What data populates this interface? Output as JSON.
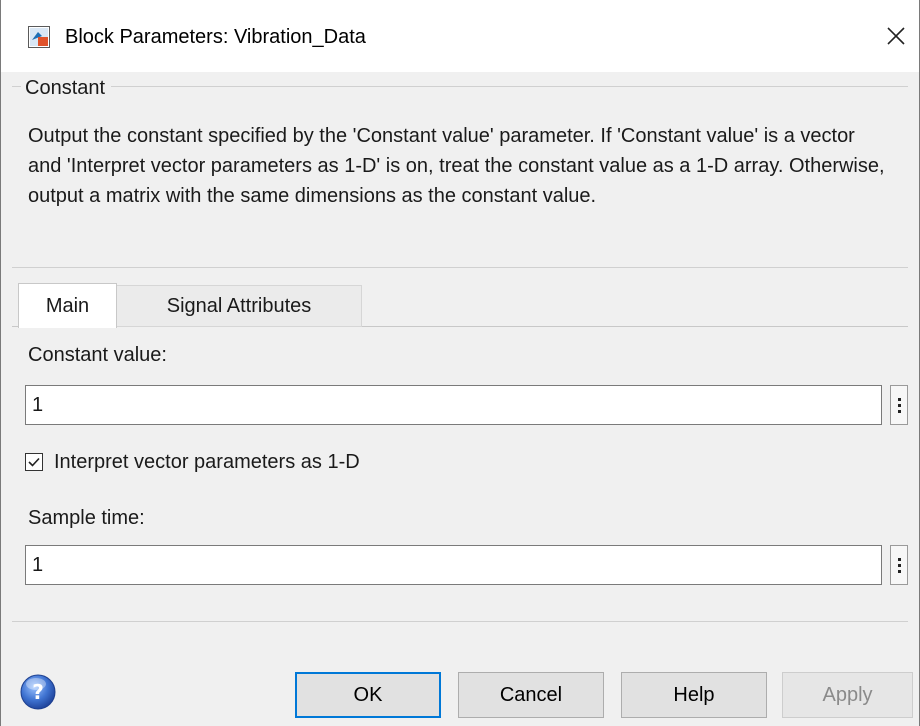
{
  "window": {
    "title": "Block Parameters: Vibration_Data",
    "close_glyph": "✕",
    "app_icon": "simulink-block-icon"
  },
  "group": {
    "label": "Constant",
    "description": "Output the constant specified by the 'Constant value' parameter. If 'Constant value' is a vector and 'Interpret vector parameters as 1-D' is on, treat the constant value as a 1-D array. Otherwise, output a matrix with the same dimensions as the constant value."
  },
  "tabs": [
    {
      "label": "Main",
      "active": true
    },
    {
      "label": "Signal Attributes",
      "active": false
    }
  ],
  "main": {
    "constant_label": "Constant value:",
    "constant_value": "1",
    "interpret_label": "Interpret vector parameters as 1-D",
    "interpret_checked": true,
    "sample_time_label": "Sample time:",
    "sample_time_value": "1"
  },
  "buttons": {
    "ok": "OK",
    "cancel": "Cancel",
    "help": "Help",
    "apply": "Apply"
  },
  "colors": {
    "focus_border": "#0078d7",
    "dialog_bg": "#f0f0f0"
  }
}
